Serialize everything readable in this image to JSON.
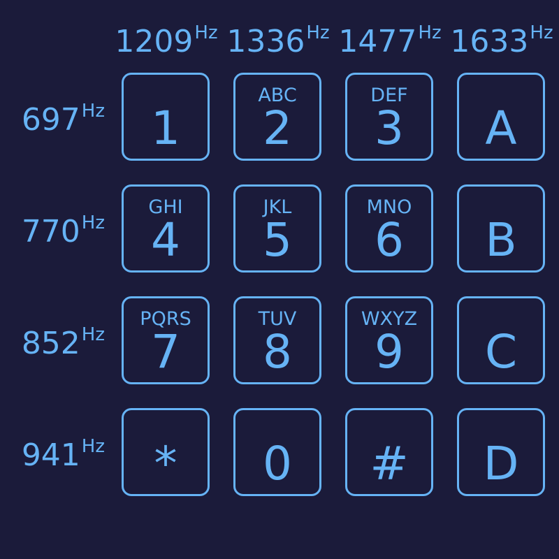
{
  "unit": "Hz",
  "column_frequencies": [
    "1209",
    "1336",
    "1477",
    "1633"
  ],
  "row_frequencies": [
    "697",
    "770",
    "852",
    "941"
  ],
  "keys": [
    [
      {
        "digit": "1",
        "letters": ""
      },
      {
        "digit": "2",
        "letters": "ABC"
      },
      {
        "digit": "3",
        "letters": "DEF"
      },
      {
        "digit": "A",
        "letters": ""
      }
    ],
    [
      {
        "digit": "4",
        "letters": "GHI"
      },
      {
        "digit": "5",
        "letters": "JKL"
      },
      {
        "digit": "6",
        "letters": "MNO"
      },
      {
        "digit": "B",
        "letters": ""
      }
    ],
    [
      {
        "digit": "7",
        "letters": "PQRS"
      },
      {
        "digit": "8",
        "letters": "TUV"
      },
      {
        "digit": "9",
        "letters": "WXYZ"
      },
      {
        "digit": "C",
        "letters": ""
      }
    ],
    [
      {
        "digit": "*",
        "letters": ""
      },
      {
        "digit": "0",
        "letters": ""
      },
      {
        "digit": "#",
        "letters": ""
      },
      {
        "digit": "D",
        "letters": ""
      }
    ]
  ],
  "colors": {
    "background": "#1b1b3a",
    "accent": "#66b3f5"
  }
}
